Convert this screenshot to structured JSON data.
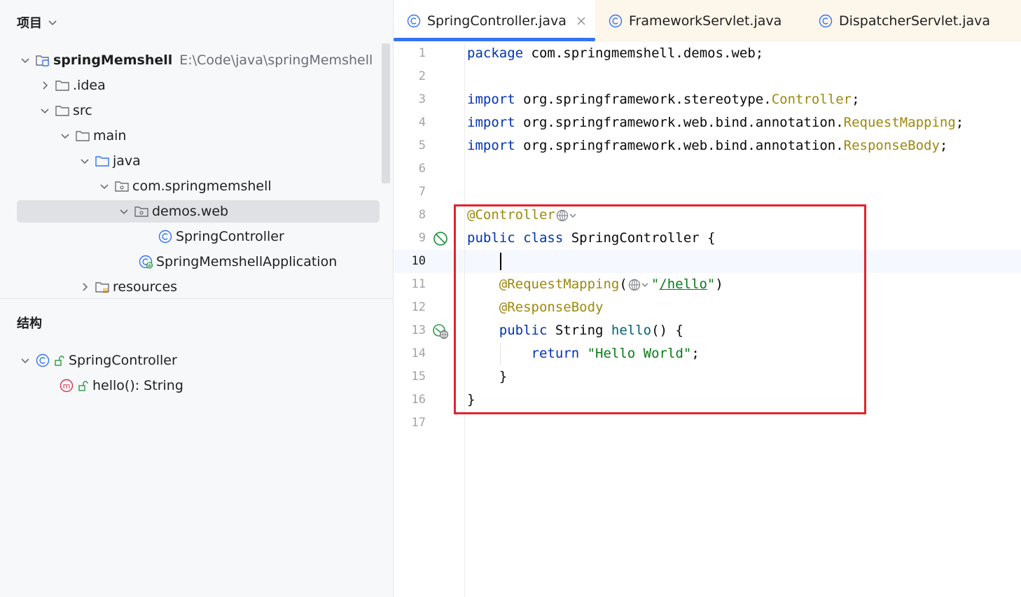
{
  "project_panel": {
    "title": "项目",
    "tree": [
      {
        "label": "springMemshell",
        "path": "E:\\Code\\java\\springMemshell"
      },
      {
        "label": ".idea"
      },
      {
        "label": "src"
      },
      {
        "label": "main"
      },
      {
        "label": "java"
      },
      {
        "label": "com.springmemshell"
      },
      {
        "label": "demos.web"
      },
      {
        "label": "SpringController"
      },
      {
        "label": "SpringMemshellApplication"
      },
      {
        "label": "resources"
      }
    ]
  },
  "structure_panel": {
    "title": "结构",
    "items": [
      {
        "label": "SpringController"
      },
      {
        "label": "hello(): String"
      }
    ]
  },
  "tabs": [
    {
      "label": "SpringController.java",
      "active": true
    },
    {
      "label": "FrameworkServlet.java",
      "active": false
    },
    {
      "label": "DispatcherServlet.java",
      "active": false
    }
  ],
  "editor": {
    "line_numbers": [
      "1",
      "2",
      "3",
      "4",
      "5",
      "6",
      "7",
      "8",
      "9",
      "10",
      "11",
      "12",
      "13",
      "14",
      "15",
      "16",
      "17"
    ],
    "current_line": "10",
    "code": {
      "l1_kw": "package",
      "l1_rest": " com.springmemshell.demos.web;",
      "l3_kw": "import",
      "l3_pkg": " org.springframework.stereotype.",
      "l3_cls": "Controller",
      "l3_end": ";",
      "l4_kw": "import",
      "l4_pkg": " org.springframework.web.bind.annotation.",
      "l4_cls": "RequestMapping",
      "l4_end": ";",
      "l5_kw": "import",
      "l5_pkg": " org.springframework.web.bind.annotation.",
      "l5_cls": "ResponseBody",
      "l5_end": ";",
      "l8_ann": "@Controller",
      "l9_kw1": "public",
      "l9_kw2": " class",
      "l9_rest": " SpringController {",
      "l11_ann": "@RequestMapping",
      "l11_open": "(",
      "l11_q1": "\"",
      "l11_url": "/hello",
      "l11_q2": "\"",
      "l11_close": ")",
      "l12_ann": "@ResponseBody",
      "l13_kw": "public",
      "l13_type": " String ",
      "l13_fn": "hello",
      "l13_rest": "() {",
      "l14_kw": "return",
      "l14_sp": " ",
      "l14_str": "\"Hello World\"",
      "l14_end": ";",
      "l15": "}",
      "l16": "}"
    }
  },
  "colors": {
    "keyword": "#0033b3",
    "annotation": "#9e880d",
    "string": "#067d17",
    "function": "#00627a",
    "highlight_box": "#e3232c",
    "tab_underline": "#3574f0"
  },
  "icons": {
    "chevron": "chevron-down-icon",
    "folder": "folder-icon",
    "package": "package-icon",
    "class": "class-icon",
    "method": "method-icon",
    "web": "globe-icon"
  }
}
